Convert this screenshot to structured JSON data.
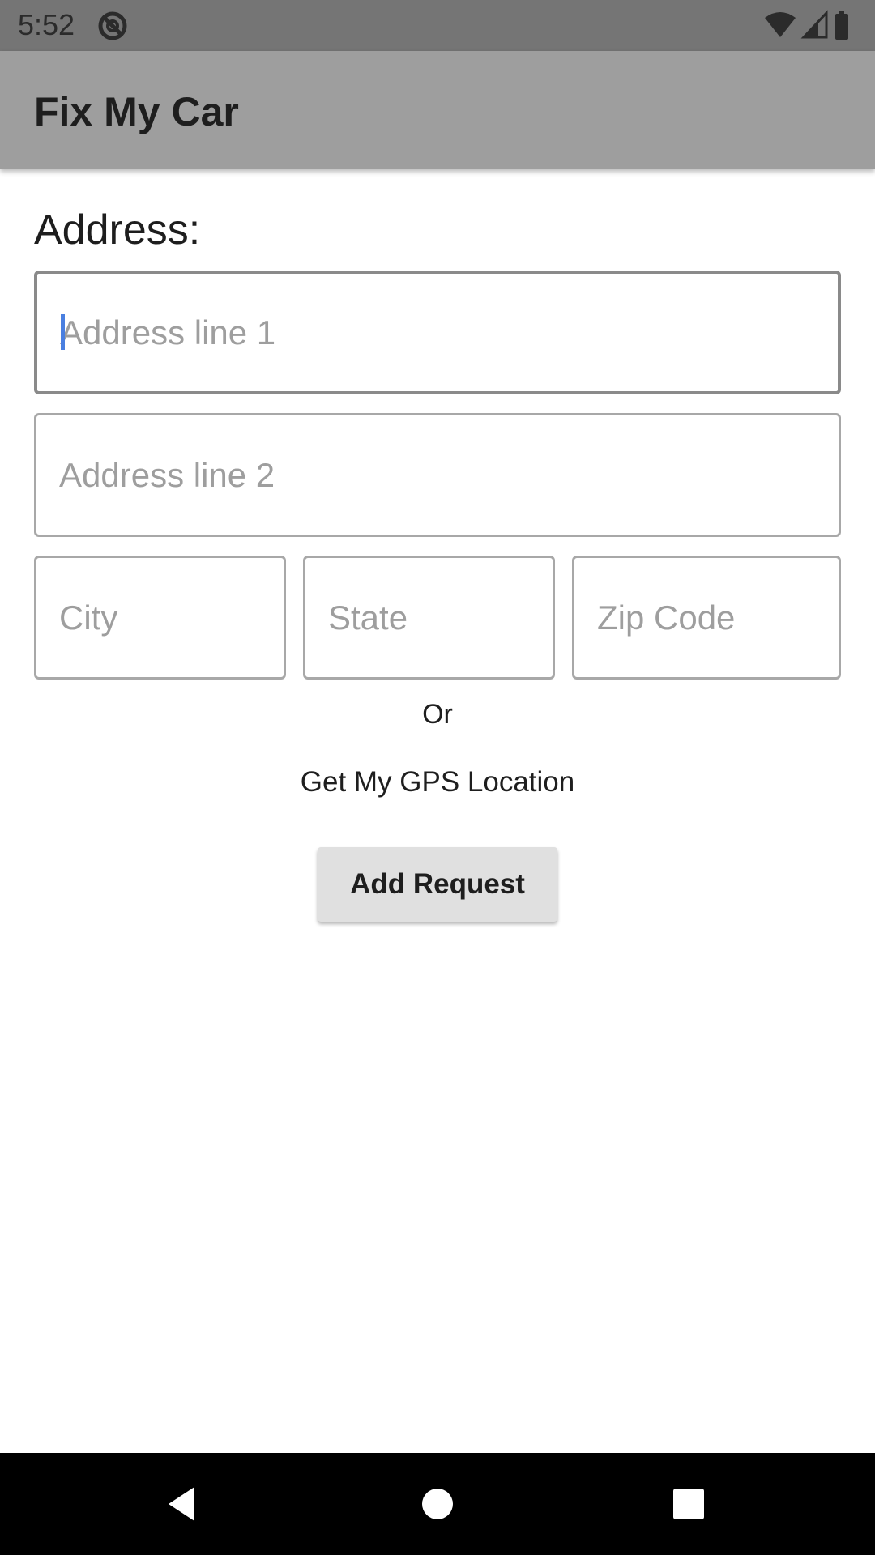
{
  "status_bar": {
    "time": "5:52",
    "notification_icon": "at-sign-icon",
    "wifi_icon": "wifi-icon",
    "signal_icon": "cell-signal-icon",
    "battery_icon": "battery-icon",
    "background_color": "#757575"
  },
  "app_bar": {
    "title": "Fix My Car",
    "background_color": "#9e9e9e"
  },
  "form": {
    "section_label": "Address:",
    "address_line1": {
      "placeholder": "Address line 1",
      "value": ""
    },
    "address_line2": {
      "placeholder": "Address line 2",
      "value": ""
    },
    "city": {
      "placeholder": "City",
      "value": ""
    },
    "state": {
      "placeholder": "State",
      "value": ""
    },
    "zip": {
      "placeholder": "Zip Code",
      "value": ""
    },
    "or_label": "Or",
    "gps_label": "Get My GPS Location",
    "submit_label": "Add Request",
    "caret_color": "#4a7fe0"
  },
  "nav_bar": {
    "back_icon": "back-triangle-icon",
    "home_icon": "home-circle-icon",
    "recents_icon": "recents-square-icon"
  }
}
